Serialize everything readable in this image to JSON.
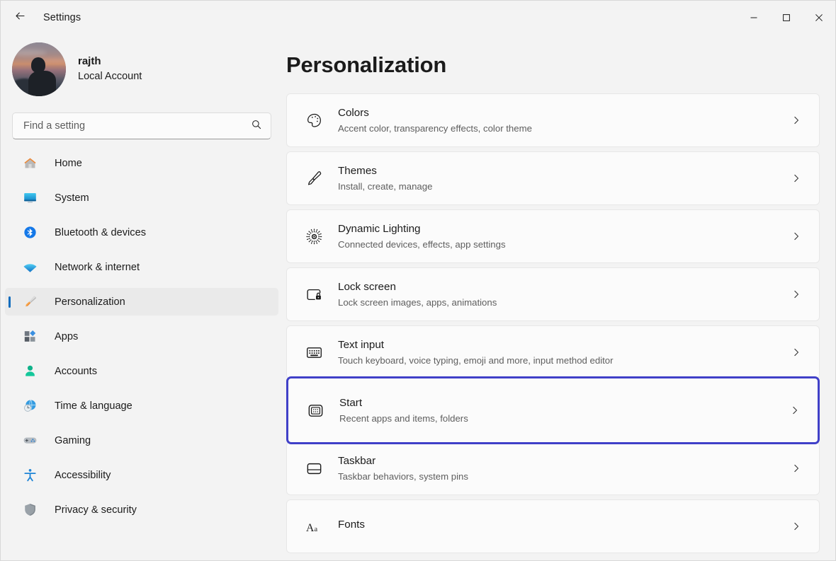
{
  "window": {
    "title": "Settings",
    "back_icon": "back-arrow-icon",
    "controls": {
      "minimize": "minimize-icon",
      "maximize": "maximize-icon",
      "close": "close-icon"
    }
  },
  "sidebar": {
    "account": {
      "name": "rajth",
      "type": "Local Account",
      "avatar": "user-avatar"
    },
    "search": {
      "placeholder": "Find a setting",
      "value": "",
      "icon": "search-icon"
    },
    "items": [
      {
        "label": "Home",
        "icon": "home-icon",
        "selected": false
      },
      {
        "label": "System",
        "icon": "system-icon",
        "selected": false
      },
      {
        "label": "Bluetooth & devices",
        "icon": "bluetooth-icon",
        "selected": false
      },
      {
        "label": "Network & internet",
        "icon": "wifi-icon",
        "selected": false
      },
      {
        "label": "Personalization",
        "icon": "paintbrush-icon",
        "selected": true
      },
      {
        "label": "Apps",
        "icon": "apps-icon",
        "selected": false
      },
      {
        "label": "Accounts",
        "icon": "accounts-icon",
        "selected": false
      },
      {
        "label": "Time & language",
        "icon": "time-language-icon",
        "selected": false
      },
      {
        "label": "Gaming",
        "icon": "gamepad-icon",
        "selected": false
      },
      {
        "label": "Accessibility",
        "icon": "accessibility-icon",
        "selected": false
      },
      {
        "label": "Privacy & security",
        "icon": "shield-icon",
        "selected": false
      }
    ]
  },
  "main": {
    "title": "Personalization",
    "cards": [
      {
        "title": "Colors",
        "subtitle": "Accent color, transparency effects, color theme",
        "icon": "palette-icon",
        "focused": false
      },
      {
        "title": "Themes",
        "subtitle": "Install, create, manage",
        "icon": "paintbrush-icon",
        "focused": false
      },
      {
        "title": "Dynamic Lighting",
        "subtitle": "Connected devices, effects, app settings",
        "icon": "dynamic-lighting-icon",
        "focused": false
      },
      {
        "title": "Lock screen",
        "subtitle": "Lock screen images, apps, animations",
        "icon": "lock-screen-icon",
        "focused": false
      },
      {
        "title": "Text input",
        "subtitle": "Touch keyboard, voice typing, emoji and more, input method editor",
        "icon": "keyboard-icon",
        "focused": false
      },
      {
        "title": "Start",
        "subtitle": "Recent apps and items, folders",
        "icon": "start-icon",
        "focused": true
      },
      {
        "title": "Taskbar",
        "subtitle": "Taskbar behaviors, system pins",
        "icon": "taskbar-icon",
        "focused": false
      },
      {
        "title": "Fonts",
        "subtitle": "",
        "icon": "fonts-icon",
        "focused": false
      }
    ],
    "chevron_icon": "chevron-right-icon"
  },
  "colors": {
    "accent": "#0f6cbd",
    "focus_border": "#4040c8",
    "window_bg": "#f3f3f3",
    "card_bg": "#fbfbfb",
    "text": "#1b1b1b",
    "subtext": "#5e5e5e"
  }
}
